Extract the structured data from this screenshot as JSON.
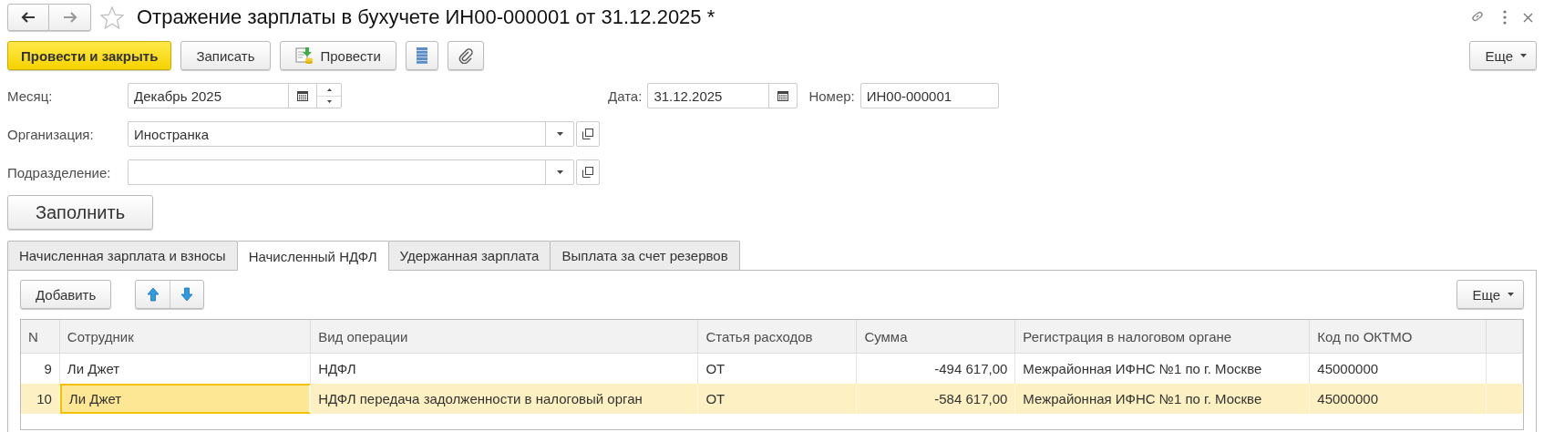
{
  "window": {
    "title": "Отражение зарплаты в бухучете ИН00-000001 от 31.12.2025 *",
    "favorite": false
  },
  "toolbar": {
    "buttons": [
      {
        "kind": "primary",
        "label": "Провести и закрыть"
      },
      {
        "kind": "plain",
        "label": "Записать"
      },
      {
        "kind": "post",
        "label": "Провести"
      },
      {
        "kind": "list-icon"
      },
      {
        "kind": "clip-icon"
      }
    ],
    "more": "Еще"
  },
  "fields": {
    "month": {
      "label": "Месяц:",
      "value": "Декабрь 2025"
    },
    "date": {
      "label": "Дата:",
      "value": "31.12.2025"
    },
    "number": {
      "label": "Номер:",
      "value": "ИН00-000001"
    },
    "organization": {
      "label": "Организация:",
      "value": "Иностранка"
    },
    "department": {
      "label": "Подразделение:"
    }
  },
  "fill_button": "Заполнить",
  "tabs": [
    {
      "label": "Начисленная зарплата и взносы",
      "selected": false
    },
    {
      "label": "Начисленный НДФЛ",
      "selected": true
    },
    {
      "label": "Удержанная зарплата",
      "selected": false
    },
    {
      "label": "Выплата за счет резервов",
      "selected": false
    }
  ],
  "table_toolbar": {
    "add": "Добавить",
    "more": "Еще"
  },
  "table": {
    "columns": [
      "N",
      "Сотрудник",
      "Вид операции",
      "Статья расходов",
      "Сумма",
      "Регистрация в налоговом органе",
      "Код по ОКТМО"
    ],
    "rows": [
      {
        "selected": false,
        "cells": [
          {
            "text": "9",
            "focused": false
          },
          {
            "text": "Ли Джет",
            "focused": false
          },
          {
            "text": "НДФЛ",
            "focused": false
          },
          {
            "text": "ОТ",
            "focused": false
          },
          {
            "text": "-494 617,00",
            "focused": false
          },
          {
            "text": "Межрайонная ИФНС №1 по г. Москве",
            "focused": false
          },
          {
            "text": "45000000",
            "focused": false
          }
        ]
      },
      {
        "selected": true,
        "cells": [
          {
            "text": "10",
            "focused": false
          },
          {
            "text": "Ли Джет",
            "focused": true
          },
          {
            "text": "НДФЛ передача задолженности в налоговый орган",
            "focused": false
          },
          {
            "text": "ОТ",
            "focused": false
          },
          {
            "text": "-584 617,00",
            "focused": false
          },
          {
            "text": "Межрайонная ИФНС №1 по г. Москве",
            "focused": false
          },
          {
            "text": "45000000",
            "focused": false
          }
        ]
      }
    ]
  }
}
